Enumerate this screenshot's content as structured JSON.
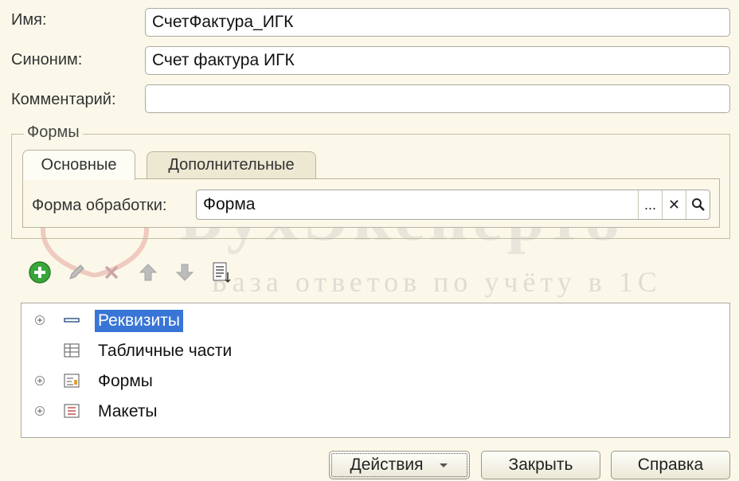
{
  "fields": {
    "name_label": "Имя:",
    "name_value": "СчетФактура_ИГК",
    "synonym_label": "Синоним:",
    "synonym_value": "Счет фактура ИГК",
    "comment_label": "Комментарий:",
    "comment_value": ""
  },
  "forms_group": {
    "title": "Формы",
    "tabs": [
      {
        "label": "Основные",
        "active": true
      },
      {
        "label": "Дополнительные",
        "active": false
      }
    ],
    "processing_form_label": "Форма обработки:",
    "processing_form_value": "Форма",
    "ellipsis_label": "...",
    "clear_label": "✕",
    "search_label": "⌕"
  },
  "toolbar": {
    "icons": [
      "add-icon",
      "edit-icon",
      "delete-icon",
      "move-up-icon",
      "move-down-icon",
      "list-icon"
    ]
  },
  "tree": {
    "items": [
      {
        "label": "Реквизиты",
        "expandable": true,
        "selected": true,
        "icon": "attributes-icon"
      },
      {
        "label": "Табличные части",
        "expandable": false,
        "selected": false,
        "icon": "tabular-parts-icon"
      },
      {
        "label": "Формы",
        "expandable": true,
        "selected": false,
        "icon": "forms-icon"
      },
      {
        "label": "Макеты",
        "expandable": true,
        "selected": false,
        "icon": "templates-icon"
      }
    ]
  },
  "buttons": {
    "actions": "Действия",
    "close": "Закрыть",
    "help": "Справка"
  },
  "watermark": {
    "brand": "БухЭксперт8",
    "tagline": "База ответов по учёту в 1С"
  },
  "colors": {
    "background": "#fbf8ea",
    "selection": "#3875d7",
    "add_green": "#3aa63a"
  }
}
